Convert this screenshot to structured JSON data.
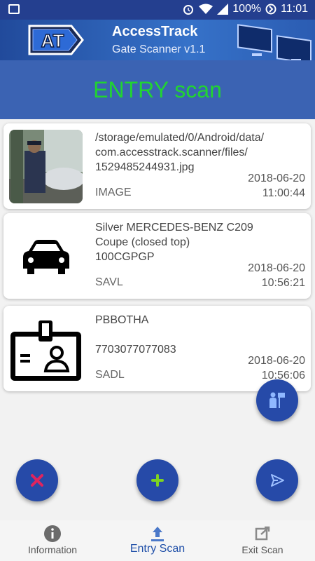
{
  "status": {
    "battery": "100%",
    "time": "11:01"
  },
  "app": {
    "title": "AccessTrack",
    "subtitle": "Gate Scanner v1.1",
    "logo_text": "AT"
  },
  "banner": {
    "text": "ENTRY scan",
    "color": "#21d431"
  },
  "cards": [
    {
      "title": "/storage/emulated/0/Android/data/\ncom.accesstrack.scanner/files/\n1529485244931.jpg",
      "type": "IMAGE",
      "date": "2018-06-20",
      "time": "11:00:44",
      "icon": "photo-thumbnail"
    },
    {
      "title": "Silver MERCEDES-BENZ C209\nCoupe (closed top)\n100CGPGP",
      "type": "SAVL",
      "date": "2018-06-20",
      "time": "10:56:21",
      "icon": "car-icon"
    },
    {
      "title": "PBBOTHA\n\n7703077077083",
      "type": "SADL",
      "date": "2018-06-20",
      "time": "10:56:06",
      "icon": "id-badge-icon"
    }
  ],
  "nav": [
    {
      "label": "Information",
      "icon": "info-icon"
    },
    {
      "label": "Entry Scan",
      "icon": "upload-icon"
    },
    {
      "label": "Exit Scan",
      "icon": "exit-icon"
    }
  ],
  "colors": {
    "primary": "#264aa8",
    "accent_red": "#e0245e",
    "accent_green": "#7ed321"
  }
}
